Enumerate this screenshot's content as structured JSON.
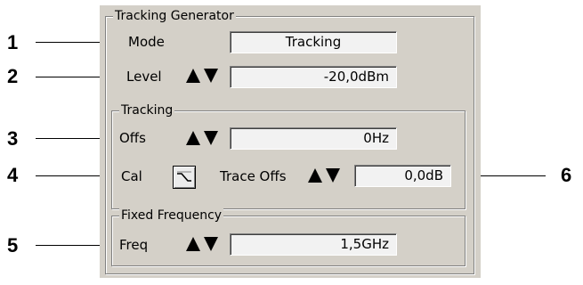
{
  "callouts": [
    "1",
    "2",
    "3",
    "4",
    "5",
    "6"
  ],
  "tracking_generator": {
    "title": "Tracking Generator",
    "mode_label": "Mode",
    "mode_value": "Tracking",
    "level_label": "Level",
    "level_value": "-20,0dBm"
  },
  "tracking": {
    "title": "Tracking",
    "offs_label": "Offs",
    "offs_value": "0Hz",
    "cal_label": "Cal",
    "trace_offs_label": "Trace Offs",
    "trace_offs_value": "0,0dB"
  },
  "fixed_frequency": {
    "title": "Fixed Frequency",
    "freq_label": "Freq",
    "freq_value": "1,5GHz"
  },
  "icons": {
    "spin": "up-down-arrow-icon",
    "cal": "calibration-curve-icon"
  }
}
